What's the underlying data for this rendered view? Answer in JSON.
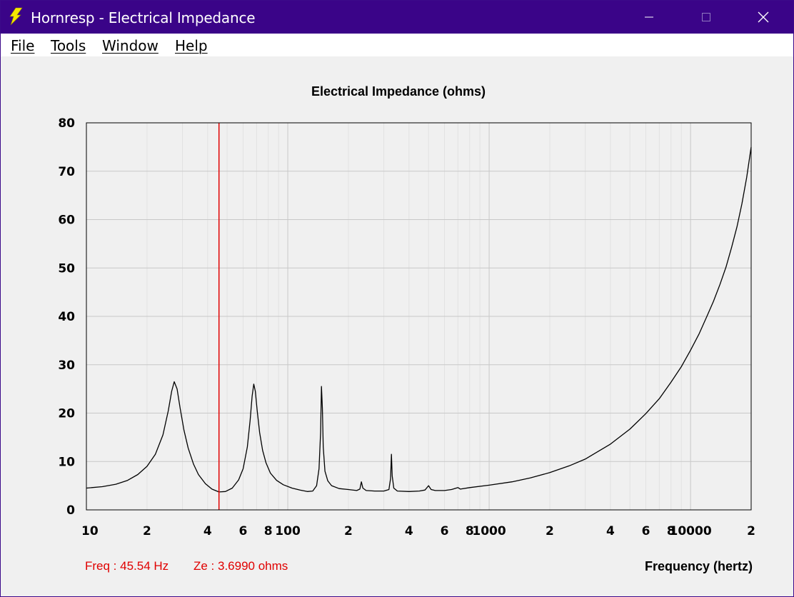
{
  "window": {
    "title": "Hornresp - Electrical Impedance",
    "icon": "lightning-bolt-icon",
    "titlebar_color": "#3a0488"
  },
  "menu": [
    {
      "label": "File"
    },
    {
      "label": "Tools"
    },
    {
      "label": "Window"
    },
    {
      "label": "Help"
    }
  ],
  "readout": {
    "freq": "Freq : 45.54 Hz",
    "ze": "Ze : 3.6990 ohms"
  },
  "chart_data": {
    "type": "line",
    "title": "Electrical Impedance (ohms)",
    "xlabel": "Frequency (hertz)",
    "ylabel": "",
    "x_scale": "log",
    "xlim": [
      10,
      20000
    ],
    "ylim": [
      0,
      80
    ],
    "grid": true,
    "y_ticks": [
      0,
      10,
      20,
      30,
      40,
      50,
      60,
      70,
      80
    ],
    "x_tick_labels": [
      {
        "value": 10,
        "label": "10"
      },
      {
        "value": 20,
        "label": "2"
      },
      {
        "value": 40,
        "label": "4"
      },
      {
        "value": 60,
        "label": "6"
      },
      {
        "value": 80,
        "label": "8"
      },
      {
        "value": 100,
        "label": "100"
      },
      {
        "value": 200,
        "label": "2"
      },
      {
        "value": 400,
        "label": "4"
      },
      {
        "value": 600,
        "label": "6"
      },
      {
        "value": 800,
        "label": "8"
      },
      {
        "value": 1000,
        "label": "1000"
      },
      {
        "value": 2000,
        "label": "2"
      },
      {
        "value": 4000,
        "label": "4"
      },
      {
        "value": 6000,
        "label": "6"
      },
      {
        "value": 8000,
        "label": "8"
      },
      {
        "value": 10000,
        "label": "10000"
      },
      {
        "value": 20000,
        "label": "2"
      }
    ],
    "cursor": {
      "freq_hz": 45.54,
      "ze_ohms": 3.699,
      "color": "#e00000"
    },
    "series": [
      {
        "color": "#000000",
        "points": [
          [
            10,
            4.5
          ],
          [
            12,
            4.8
          ],
          [
            14,
            5.3
          ],
          [
            16,
            6.1
          ],
          [
            18,
            7.3
          ],
          [
            20,
            9.0
          ],
          [
            22,
            11.5
          ],
          [
            24,
            15.5
          ],
          [
            25.5,
            20.5
          ],
          [
            26.5,
            24.5
          ],
          [
            27.3,
            26.5
          ],
          [
            28.2,
            25.0
          ],
          [
            29.2,
            21.0
          ],
          [
            30.5,
            16.5
          ],
          [
            32,
            12.8
          ],
          [
            34,
            9.5
          ],
          [
            36,
            7.3
          ],
          [
            39,
            5.4
          ],
          [
            42,
            4.3
          ],
          [
            45.5,
            3.7
          ],
          [
            49,
            3.8
          ],
          [
            53,
            4.5
          ],
          [
            57,
            6.2
          ],
          [
            60,
            8.5
          ],
          [
            63,
            13.0
          ],
          [
            65,
            18.5
          ],
          [
            66.5,
            23.5
          ],
          [
            67.8,
            26.0
          ],
          [
            69,
            24.5
          ],
          [
            70.5,
            20.5
          ],
          [
            72.5,
            16.0
          ],
          [
            75,
            12.3
          ],
          [
            78,
            9.7
          ],
          [
            82,
            7.6
          ],
          [
            88,
            6.1
          ],
          [
            95,
            5.2
          ],
          [
            105,
            4.5
          ],
          [
            115,
            4.1
          ],
          [
            125,
            3.8
          ],
          [
            133,
            3.9
          ],
          [
            139,
            5.0
          ],
          [
            143,
            8.5
          ],
          [
            145.5,
            16.0
          ],
          [
            147,
            25.5
          ],
          [
            148.5,
            21.0
          ],
          [
            150,
            13.0
          ],
          [
            153,
            8.0
          ],
          [
            158,
            6.0
          ],
          [
            165,
            5.0
          ],
          [
            180,
            4.4
          ],
          [
            200,
            4.2
          ],
          [
            220,
            4.0
          ],
          [
            228,
            4.3
          ],
          [
            232,
            5.8
          ],
          [
            236,
            4.5
          ],
          [
            245,
            4.0
          ],
          [
            270,
            3.9
          ],
          [
            300,
            3.9
          ],
          [
            318,
            4.2
          ],
          [
            324,
            6.5
          ],
          [
            327,
            11.5
          ],
          [
            330,
            7.0
          ],
          [
            336,
            4.5
          ],
          [
            350,
            3.9
          ],
          [
            400,
            3.8
          ],
          [
            450,
            3.9
          ],
          [
            480,
            4.1
          ],
          [
            500,
            5.0
          ],
          [
            515,
            4.2
          ],
          [
            540,
            4.0
          ],
          [
            600,
            4.0
          ],
          [
            650,
            4.2
          ],
          [
            700,
            4.6
          ],
          [
            720,
            4.3
          ],
          [
            800,
            4.6
          ],
          [
            1000,
            5.1
          ],
          [
            1300,
            5.8
          ],
          [
            1600,
            6.6
          ],
          [
            2000,
            7.7
          ],
          [
            2500,
            9.1
          ],
          [
            3000,
            10.5
          ],
          [
            4000,
            13.6
          ],
          [
            5000,
            16.7
          ],
          [
            6000,
            19.9
          ],
          [
            7000,
            23.0
          ],
          [
            8000,
            26.4
          ],
          [
            9000,
            29.6
          ],
          [
            10000,
            33.0
          ],
          [
            11000,
            36.3
          ],
          [
            12000,
            39.8
          ],
          [
            13000,
            43.1
          ],
          [
            14000,
            46.6
          ],
          [
            15000,
            50.2
          ],
          [
            16000,
            54.3
          ],
          [
            17000,
            58.5
          ],
          [
            18000,
            63.3
          ],
          [
            19000,
            68.7
          ],
          [
            20000,
            75.0
          ]
        ]
      }
    ]
  }
}
